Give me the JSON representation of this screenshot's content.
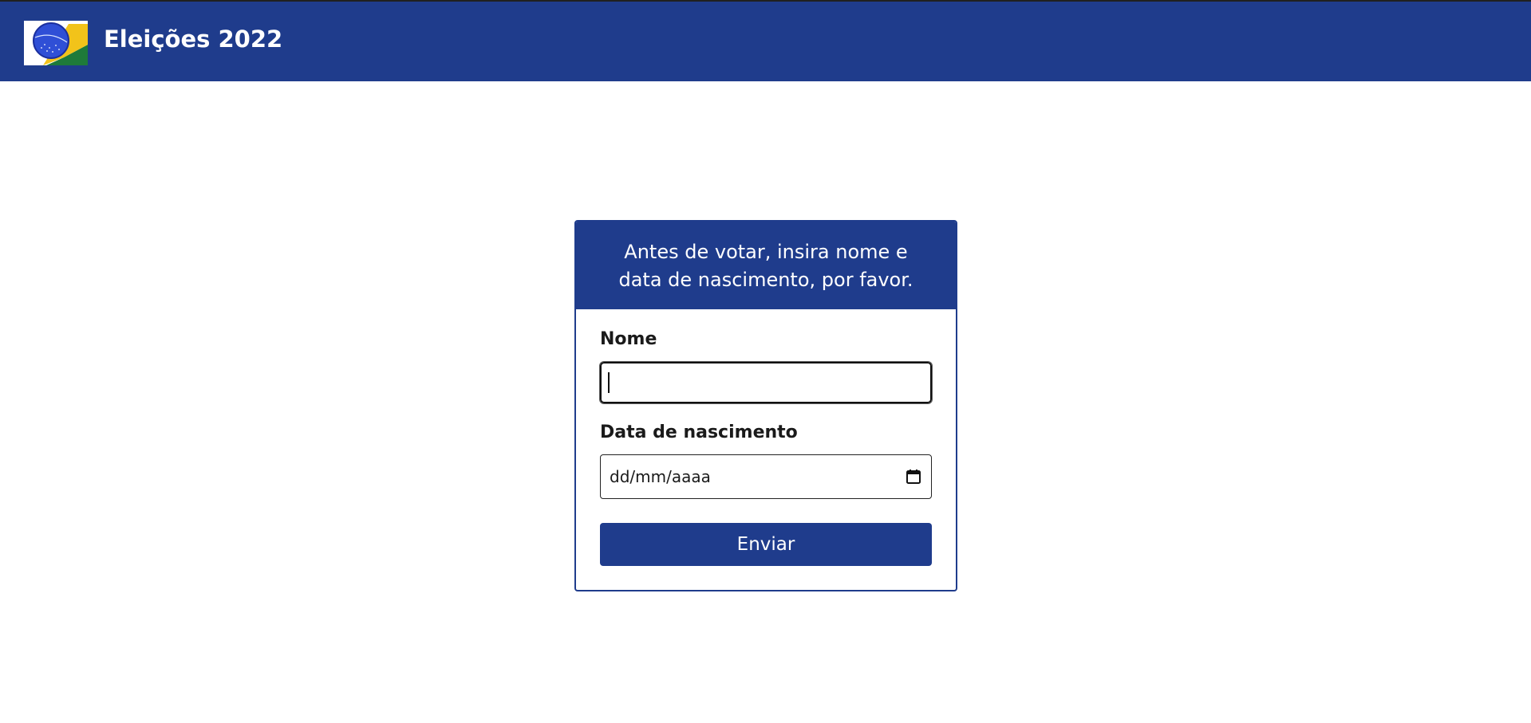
{
  "header": {
    "logo_icon": "brazil-flag-logo-icon",
    "title": "Eleições 2022",
    "background_color": "#1f3c8c"
  },
  "form": {
    "intro_text": "Antes de votar, insira nome e data de nascimento, por favor.",
    "name_label": "Nome",
    "name_value": "",
    "birthdate_label": "Data de nascimento",
    "birthdate_placeholder": "dd/mm/aaaa",
    "calendar_icon": "calendar-icon",
    "submit_label": "Enviar",
    "accent_color": "#1f3c8c"
  }
}
